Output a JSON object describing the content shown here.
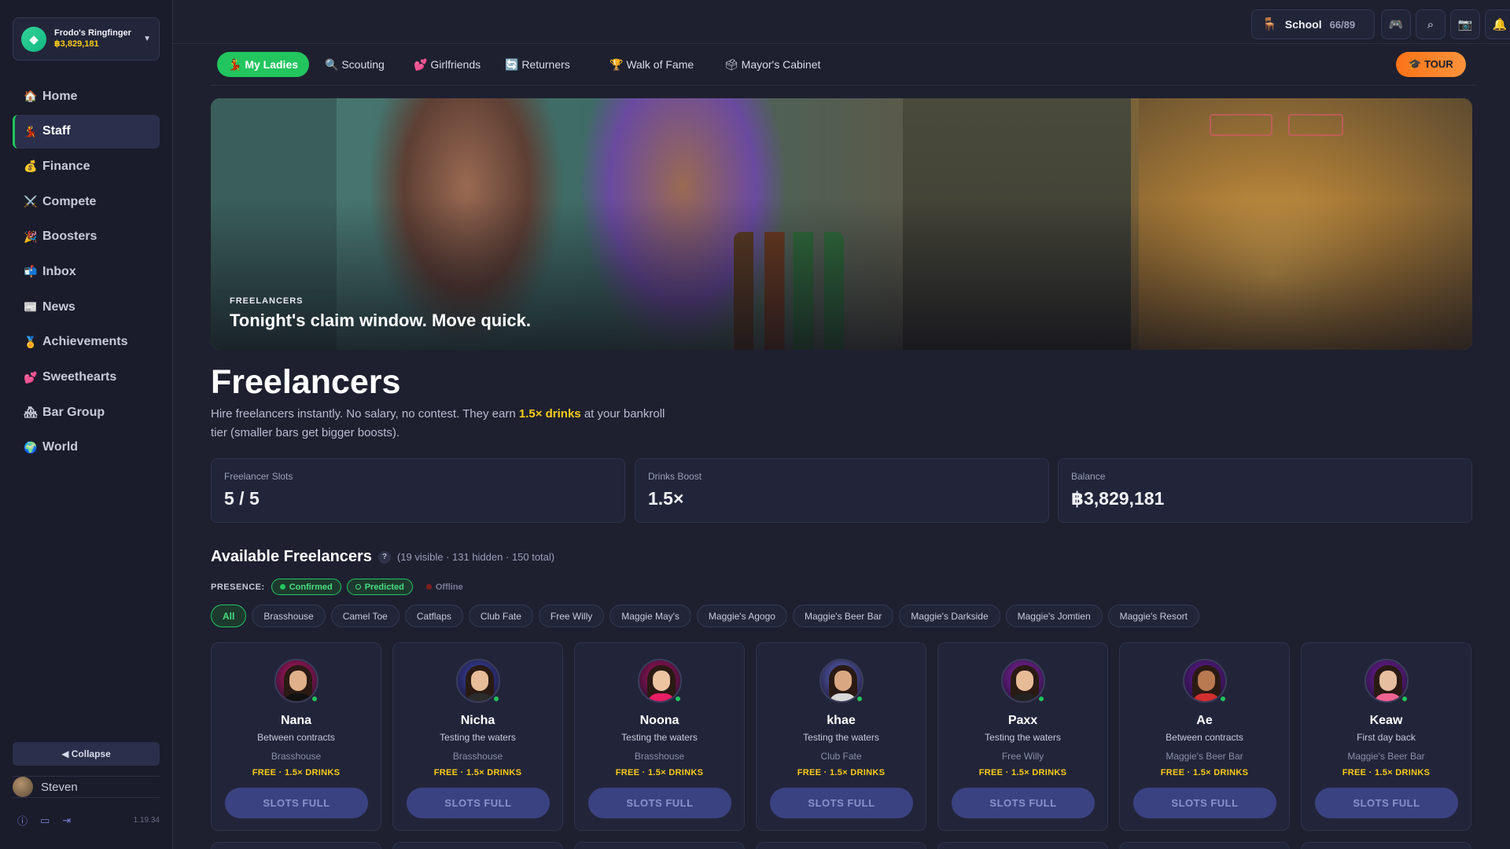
{
  "account": {
    "name": "Frodo's Ringfinger",
    "balance": "฿3,829,181",
    "icon": "gem-icon"
  },
  "nav": [
    {
      "label": "Home",
      "icon": "🏠",
      "active": false
    },
    {
      "label": "Staff",
      "icon": "💃",
      "active": true
    },
    {
      "label": "Finance",
      "icon": "💰",
      "active": false
    },
    {
      "label": "Compete",
      "icon": "⚔️",
      "active": false
    },
    {
      "label": "Boosters",
      "icon": "🎉",
      "active": false
    },
    {
      "label": "Inbox",
      "icon": "📬",
      "active": false
    },
    {
      "label": "News",
      "icon": "📰",
      "active": false
    },
    {
      "label": "Achievements",
      "icon": "🏅",
      "active": false
    },
    {
      "label": "Sweethearts",
      "icon": "💕",
      "active": false
    },
    {
      "label": "Bar Group",
      "icon": "🏘",
      "active": false
    },
    {
      "label": "World",
      "icon": "🌍",
      "active": false
    }
  ],
  "sidebar": {
    "collapse_label": "◀ Collapse",
    "user": "Steven",
    "version": "1.19.34"
  },
  "topbar": {
    "school_label": "School",
    "school_count": "66/89",
    "school_icon": "🪑"
  },
  "tabs": [
    {
      "label": "💃 My Ladies",
      "active": true
    },
    {
      "label": "🔍 Scouting",
      "active": false
    },
    {
      "label": "💕 Girlfriends",
      "active": false
    },
    {
      "label": "🔄 Returners",
      "active": false
    },
    {
      "label": "🏆 Walk of Fame",
      "active": false
    },
    {
      "label": "🗳 Mayor's Cabinet",
      "active": false
    }
  ],
  "tour_label": "🎓 TOUR",
  "hero": {
    "kicker": "FREELANCERS",
    "title": "Tonight's claim window. Move quick."
  },
  "page": {
    "title": "Freelancers",
    "desc_a": "Hire freelancers instantly. No salary, no contest. They earn ",
    "desc_hl": "1.5× drinks",
    "desc_b": " at your bankroll tier (smaller bars get bigger boosts)."
  },
  "stats": [
    {
      "label": "Freelancer Slots",
      "value": "5 / 5"
    },
    {
      "label": "Drinks Boost",
      "value": "1.5×"
    },
    {
      "label": "Balance",
      "value": "฿3,829,181"
    }
  ],
  "available": {
    "title": "Available Freelancers",
    "help": "?",
    "meta": "(19 visible · 131 hidden · 150 total)"
  },
  "presence": {
    "label": "PRESENCE:",
    "confirmed": "Confirmed",
    "predicted": "Predicted",
    "offline": "Offline"
  },
  "filters": [
    "All",
    "Brasshouse",
    "Camel Toe",
    "Catflaps",
    "Club Fate",
    "Free Willy",
    "Maggie May's",
    "Maggie's Agogo",
    "Maggie's Beer Bar",
    "Maggie's Darkside",
    "Maggie's Jomtien",
    "Maggie's Resort"
  ],
  "cards": [
    {
      "name": "Nana",
      "status": "Between contracts",
      "bar": "Brasshouse",
      "offer": "FREE · 1.5× DRINKS",
      "button": "SLOTS FULL",
      "bg": "#c2185b",
      "skin": "#e0b08a",
      "outfit": "#111"
    },
    {
      "name": "Nicha",
      "status": "Testing the waters",
      "bar": "Brasshouse",
      "offer": "FREE · 1.5× DRINKS",
      "button": "SLOTS FULL",
      "bg": "#3949ab",
      "skin": "#e6bd98",
      "outfit": "#2b2b2b"
    },
    {
      "name": "Noona",
      "status": "Testing the waters",
      "bar": "Brasshouse",
      "offer": "FREE · 1.5× DRINKS",
      "button": "SLOTS FULL",
      "bg": "#ad1457",
      "skin": "#ecc4a2",
      "outfit": "#e91e63"
    },
    {
      "name": "khae",
      "status": "Testing the waters",
      "bar": "Club Fate",
      "offer": "FREE · 1.5× DRINKS",
      "button": "SLOTS FULL",
      "bg": "#5c6bc0",
      "skin": "#d9a882",
      "outfit": "#d8d8d8"
    },
    {
      "name": "Paxx",
      "status": "Testing the waters",
      "bar": "Free Willy",
      "offer": "FREE · 1.5× DRINKS",
      "button": "SLOTS FULL",
      "bg": "#8e24aa",
      "skin": "#e8bb97",
      "outfit": "#222"
    },
    {
      "name": "Ae",
      "status": "Between contracts",
      "bar": "Maggie's Beer Bar",
      "offer": "FREE · 1.5× DRINKS",
      "button": "SLOTS FULL",
      "bg": "#6a1b9a",
      "skin": "#b97a52",
      "outfit": "#d32f2f"
    },
    {
      "name": "Keaw",
      "status": "First day back",
      "bar": "Maggie's Beer Bar",
      "offer": "FREE · 1.5× DRINKS",
      "button": "SLOTS FULL",
      "bg": "#7b1fa2",
      "skin": "#e6bfa0",
      "outfit": "#f06292"
    }
  ]
}
